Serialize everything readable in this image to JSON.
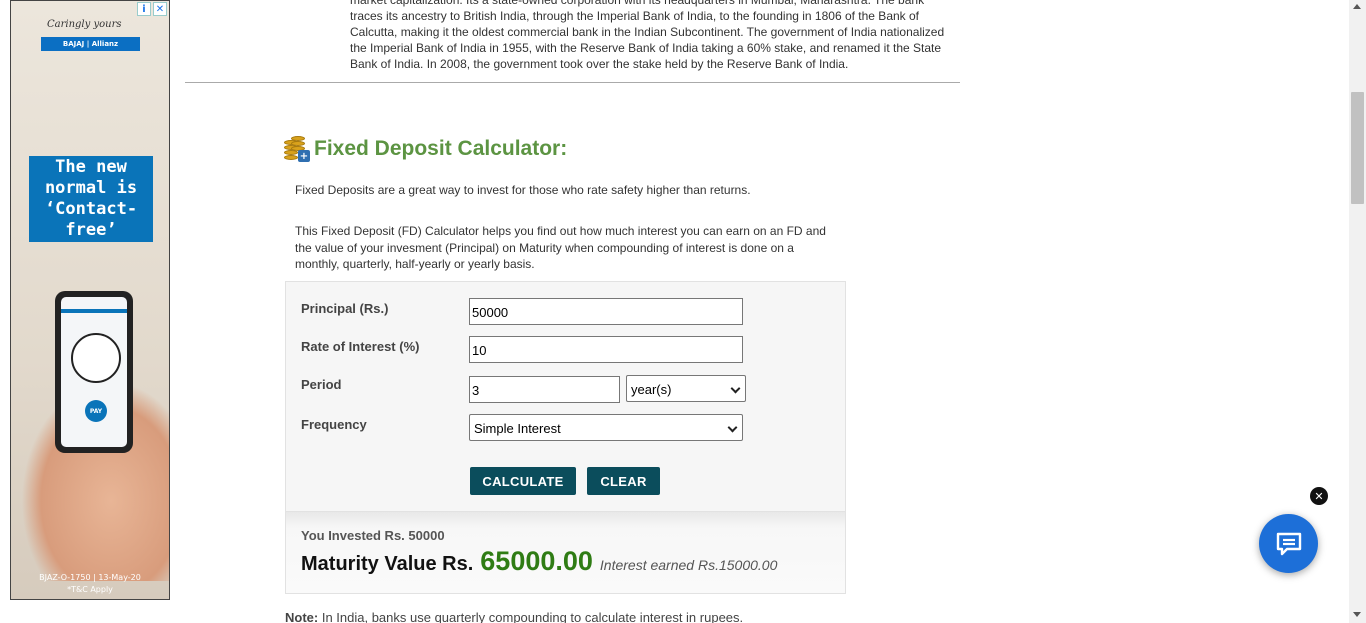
{
  "ad": {
    "tagline": "Caringly yours",
    "brand": "BAJAJ | Allianz",
    "headline": "The new normal is ‘Contact-free’",
    "pay_label": "PAY",
    "footer_code": "BJAZ-O-1750 | 13-May-20",
    "footer_apply": "*T&C Apply",
    "info_icon": "i",
    "close_icon": "✕"
  },
  "article": {
    "text": "market capitalization. Its a state-owned corporation with its headquarters in Mumbai, Maharashtra. The bank traces its ancestry to British India, through the Imperial Bank of India, to the founding in 1806 of the Bank of Calcutta, making it the oldest commercial bank in the Indian Subcontinent. The government of India nationalized the Imperial Bank of India in 1955, with the Reserve Bank of India taking a 60% stake, and renamed it the State Bank of India. In 2008, the government took over the stake held by the Reserve Bank of India."
  },
  "calculator": {
    "title": "Fixed Deposit Calculator:",
    "intro": "Fixed Deposits are a great way to invest for those who rate safety higher than returns.",
    "description": "This Fixed Deposit (FD) Calculator helps you find out how much interest you can earn on an FD and the value of your invesment (Principal) on Maturity when compounding of interest is done on a monthly, quarterly, half-yearly or yearly basis.",
    "principal_label": "Principal (Rs.)",
    "principal_value": "50000",
    "rate_label": "Rate of Interest (%)",
    "rate_value": "10",
    "period_label": "Period",
    "period_value": "3",
    "period_unit": "year(s)",
    "frequency_label": "Frequency",
    "frequency_value": "Simple Interest",
    "calculate_label": "CALCULATE",
    "clear_label": "CLEAR"
  },
  "result": {
    "invested": "You Invested Rs. 50000",
    "maturity_label": "Maturity Value Rs.",
    "maturity_value": "65000.00",
    "interest_earned": "Interest earned Rs.15000.00"
  },
  "note": {
    "label": "Note:",
    "text": " In India, banks use quarterly compounding to calculate interest in rupees."
  },
  "chat": {
    "close_icon": "✕"
  },
  "colors": {
    "heading_green": "#5c9442",
    "button_teal": "#0b4d5c",
    "maturity_green": "#2f7c14",
    "chat_blue": "#1d6fd8"
  }
}
